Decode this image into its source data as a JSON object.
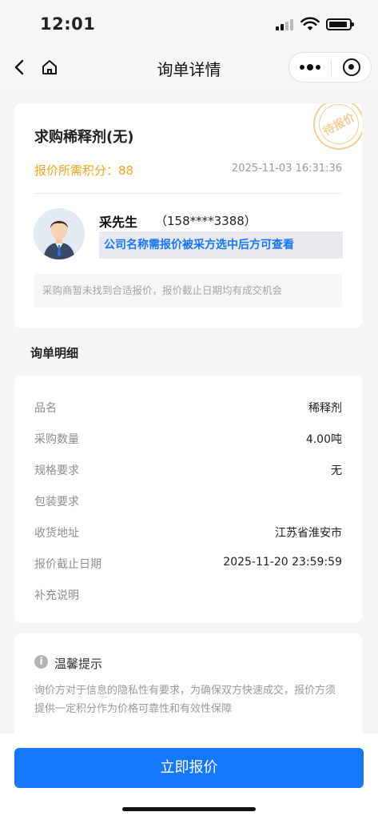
{
  "status": {
    "time": "12:01"
  },
  "nav": {
    "title": "询单详情",
    "icons": {
      "back": "chevron-left-icon",
      "home": "home-icon",
      "more": "more-dots-icon",
      "close": "mini-program-close-icon"
    }
  },
  "inquiry": {
    "title": "求购稀释剂(无)",
    "stamp": "待报价",
    "points_label": "报价所需积分：",
    "points_value": "88",
    "date": "2025-11-03 16:31:36",
    "buyer_name": "采先生",
    "buyer_phone": "（158****3388）",
    "company_hint": "公司名称需报价被采方选中后方可查看",
    "notice": "采购商暂未找到合适报价，报价截止日期均有成交机会"
  },
  "detail": {
    "section_title": "询单明细",
    "rows": [
      {
        "label": "品名",
        "value": "稀释剂"
      },
      {
        "label": "采购数量",
        "value": "4.00吨"
      },
      {
        "label": "规格要求",
        "value": "无"
      },
      {
        "label": "包装要求",
        "value": ""
      },
      {
        "label": "收货地址",
        "value": "江苏省淮安市"
      },
      {
        "label": "报价截止日期",
        "value": "2025-11-20 23:59:59"
      },
      {
        "label": "补充说明",
        "value": ""
      }
    ]
  },
  "tip": {
    "icon": "info-icon",
    "icon_glyph": "i",
    "title": "温馨提示",
    "text": "询价方对于信息的隐私性有要求，为确保双方快速成交，报价方须提供一定积分作为价格可靠性和有效性保障"
  },
  "action": {
    "quote_button": "立即报价"
  },
  "colors": {
    "accent": "#1677ff",
    "points": "#f5a623",
    "stamp": "#f1cf97"
  }
}
